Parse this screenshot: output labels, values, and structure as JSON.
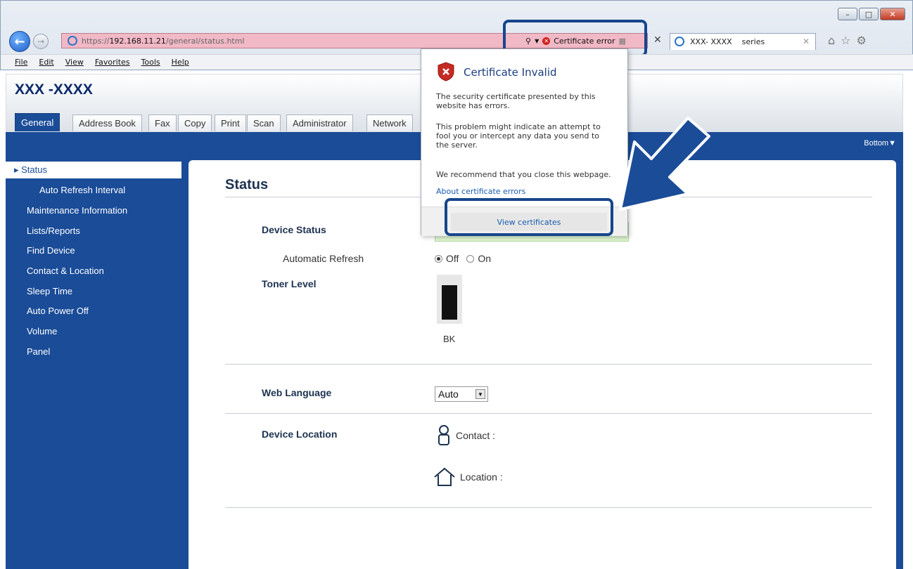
{
  "browser": {
    "address": {
      "protocol": "https://",
      "host": "192.168.11.21",
      "path": "/general/status.html"
    },
    "cert_error_label": "Certificate error",
    "tab_title": "XXX- XXXX    series",
    "menu": [
      "File",
      "Edit",
      "View",
      "Favorites",
      "Tools",
      "Help"
    ]
  },
  "page": {
    "product_name": "XXX -XXXX",
    "tabs": [
      "General",
      "Address Book",
      "Fax",
      "Copy",
      "Print",
      "Scan",
      "Administrator",
      "Network"
    ],
    "bottom_link": "Bottom▼",
    "sidebar": [
      {
        "label": "▸ Status",
        "active": true
      },
      {
        "label": "Auto Refresh Interval",
        "sub": true
      },
      {
        "label": "Maintenance Information"
      },
      {
        "label": "Lists/Reports"
      },
      {
        "label": "Find Device"
      },
      {
        "label": "Contact & Location"
      },
      {
        "label": "Sleep Time"
      },
      {
        "label": "Auto Power Off"
      },
      {
        "label": "Volume"
      },
      {
        "label": "Panel"
      }
    ],
    "heading": "Status",
    "device_status_label": "Device Status",
    "auto_refresh_label": "Automatic Refresh",
    "radio_off": "Off",
    "radio_on": "On",
    "toner_label": "Toner Level",
    "toner_color": "BK",
    "toner_level": 0.85,
    "web_language_label": "Web Language",
    "web_language_value": "Auto",
    "device_location_label": "Device Location",
    "contact_label": "Contact :",
    "location_label": "Location :"
  },
  "popup": {
    "title": "Certificate Invalid",
    "p1": "The security certificate presented by this website has errors.",
    "p2": "This problem might indicate an attempt to fool you or intercept any data you send to the server.",
    "p3": "We recommend that you close this webpage.",
    "link": "About certificate errors",
    "button": "View certificates"
  },
  "colors": {
    "accent": "#1a4c98",
    "highlight": "#16468c",
    "error": "#d1231e"
  }
}
